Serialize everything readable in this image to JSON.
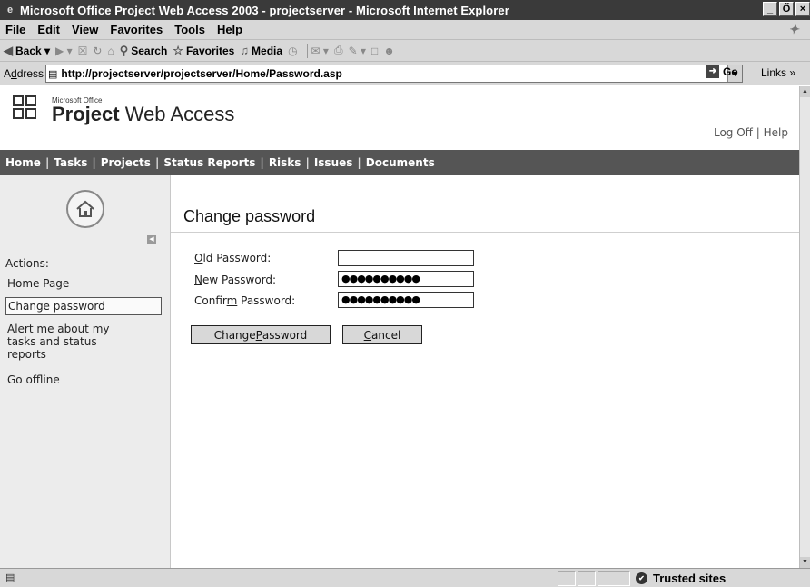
{
  "window": {
    "title": "Microsoft Office Project Web Access 2003 - projectserver - Microsoft Internet Explorer",
    "buttons": [
      "_",
      "Ő",
      "×"
    ]
  },
  "menu": {
    "items": [
      {
        "label": "File",
        "accel": "F",
        "rest": "ile"
      },
      {
        "label": "Edit",
        "accel": "E",
        "rest": "dit"
      },
      {
        "label": "View",
        "accel": "V",
        "rest": "iew"
      },
      {
        "label": "Favorites",
        "pre": "F",
        "accel": "a",
        "rest": "vorites"
      },
      {
        "label": "Tools",
        "accel": "T",
        "rest": "ools"
      },
      {
        "label": "Help",
        "accel": "H",
        "rest": "elp"
      }
    ]
  },
  "toolbar": {
    "back_label": "Back",
    "search_label": "Search",
    "favorites_label": "Favorites",
    "media_label": "Media"
  },
  "address": {
    "label_accel": "d",
    "label_pre": "A",
    "label_rest": "dress",
    "url": "http://projectserver/projectserver/Home/Password.asp",
    "go_label": "Go",
    "links_label": "Links »"
  },
  "header": {
    "ms_office": "Microsoft Office",
    "product_bold": "Project",
    "product_rest": " Web Access",
    "log_off": "Log Off",
    "separator": "|",
    "help": "Help"
  },
  "nav": {
    "items": [
      "Home",
      "Tasks",
      "Projects",
      "Status Reports",
      "Risks",
      "Issues",
      "Documents"
    ]
  },
  "sidebar": {
    "actions_label": "Actions:",
    "items": [
      {
        "label": "Home Page",
        "selected": false
      },
      {
        "label": "Change password",
        "selected": true
      },
      {
        "label": "Alert me about my tasks and status reports",
        "selected": false
      },
      {
        "label": "Go offline",
        "selected": false
      }
    ]
  },
  "main": {
    "title": "Change password",
    "fields": [
      {
        "pre": "",
        "accel": "O",
        "rest": "ld Password:",
        "value": ""
      },
      {
        "pre": "",
        "accel": "N",
        "rest": "ew Password:",
        "value": "●●●●●●●●●●"
      },
      {
        "pre": "Confir",
        "accel": "m",
        "rest": " Password:",
        "value": "●●●●●●●●●●"
      }
    ],
    "change_button": {
      "pre": "Change ",
      "accel": "P",
      "rest": "assword"
    },
    "cancel_button": {
      "pre": "",
      "accel": "C",
      "rest": "ancel"
    }
  },
  "status": {
    "zone": "Trusted sites"
  }
}
